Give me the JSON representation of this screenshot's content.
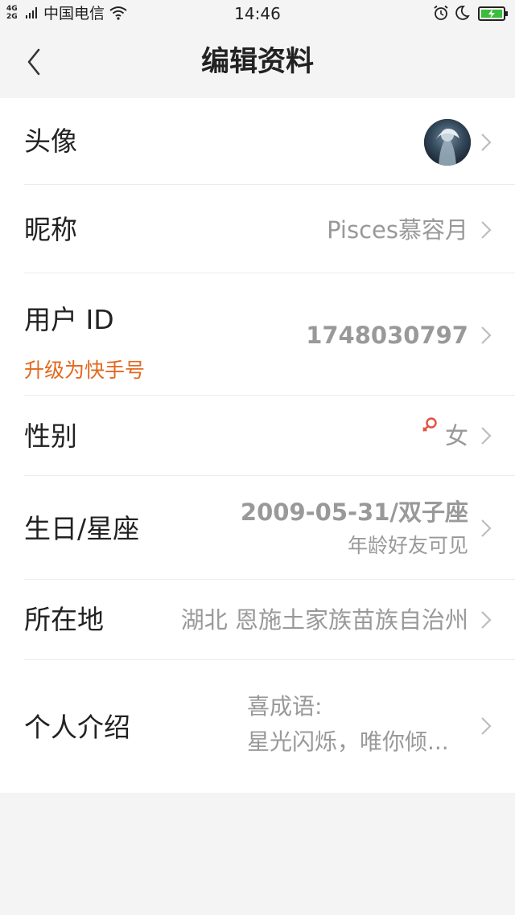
{
  "status_bar": {
    "network_top": "4G",
    "network_bottom": "2G",
    "carrier": "中国电信",
    "time": "14:46",
    "icons": [
      "signal-icon",
      "wifi-icon",
      "alarm-icon",
      "moon-icon",
      "battery-icon"
    ]
  },
  "header": {
    "title": "编辑资料",
    "back_icon": "back-arrow-icon"
  },
  "rows": {
    "avatar": {
      "label": "头像"
    },
    "nickname": {
      "label": "昵称",
      "value": "Pisces慕容月"
    },
    "user_id": {
      "label": "用户 ID",
      "value": "1748030797",
      "upgrade_link": "升级为快手号"
    },
    "gender": {
      "label": "性别",
      "value": "女",
      "icon": "female-symbol-icon"
    },
    "birthday": {
      "label": "生日/星座",
      "value": "2009-05-31/双子座",
      "note": "年龄好友可见"
    },
    "location": {
      "label": "所在地",
      "value": "湖北 恩施土家族苗族自治州"
    },
    "intro": {
      "label": "个人介绍",
      "line1": "喜成语:",
      "line2": "星光闪烁，唯你倾..."
    }
  },
  "colors": {
    "accent_orange": "#e2691f",
    "female_icon": "#e4503f",
    "value_grey": "#999999",
    "battery_green": "#3bbd3b"
  }
}
